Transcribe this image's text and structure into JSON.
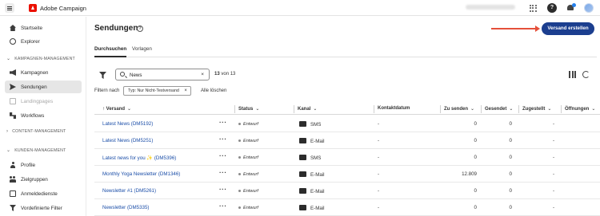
{
  "topbar": {
    "app_name": "Adobe Campaign",
    "help_glyph": "?",
    "icons": [
      "menu-icon",
      "adobe-logo",
      "apps-grid-icon",
      "help-icon",
      "bell-icon",
      "avatar"
    ]
  },
  "sidebar": {
    "top_items": [
      {
        "label": "Startseite",
        "icon": "home-icon"
      },
      {
        "label": "Explorer",
        "icon": "compass-icon"
      }
    ],
    "sections": [
      {
        "label": "KAMPAGNEN-MANAGEMENT",
        "expanded": true
      },
      {
        "label": "CONTENT-MANAGEMENT",
        "expanded": false
      },
      {
        "label": "KUNDEN-MANAGEMENT",
        "expanded": true
      }
    ],
    "campaign_items": [
      {
        "label": "Kampagnen",
        "icon": "megaphone-icon"
      },
      {
        "label": "Sendungen",
        "icon": "send-icon",
        "active": true
      },
      {
        "label": "Landingpages",
        "icon": "page-icon",
        "disabled": true
      },
      {
        "label": "Workflows",
        "icon": "workflow-icon"
      }
    ],
    "customer_items": [
      {
        "label": "Profile",
        "icon": "person-icon"
      },
      {
        "label": "Zielgruppen",
        "icon": "group-icon"
      },
      {
        "label": "Anmeldedienste",
        "icon": "service-icon"
      },
      {
        "label": "Vordefinierte Filter",
        "icon": "filter-icon"
      }
    ]
  },
  "page": {
    "title": "Sendungen",
    "create_button": "Versand erstellen",
    "tabs": [
      "Durchsuchen",
      "Vorlagen"
    ],
    "search": {
      "value": "News",
      "clear": "×"
    },
    "count_number": "13",
    "count_rest": "von 13",
    "filters_label": "Filtern nach",
    "filter_chip": "Typ: Nur Nicht-Testversand",
    "filter_chip_clear": "×",
    "clear_all": "Alle löschen"
  },
  "table": {
    "columns": {
      "versand": "Versand",
      "status": "Status",
      "kanal": "Kanal",
      "kontaktdatum": "Kontaktdatum",
      "zu_senden": "Zu senden",
      "gesendet": "Gesendet",
      "zugestellt": "Zugestellt",
      "oeffnungen": "Öffnungen"
    },
    "rows": [
      {
        "name": "Latest News (DM5192)",
        "status": "Entwurf",
        "channel": "SMS",
        "date": "-",
        "to_send": "0",
        "sent": "0",
        "delivered": "-"
      },
      {
        "name": "Latest News (DM5251)",
        "status": "Entwurf",
        "channel": "E-Mail",
        "date": "-",
        "to_send": "0",
        "sent": "0",
        "delivered": "-"
      },
      {
        "name": "Latest news for you ",
        "name_suffix": "(DM5396)",
        "sparkle": "✨",
        "status": "Entwurf",
        "channel": "SMS",
        "date": "-",
        "to_send": "0",
        "sent": "0",
        "delivered": "-"
      },
      {
        "name": "Monthly Yoga Newsletter (DM1346)",
        "status": "Entwurf",
        "channel": "E-Mail",
        "date": "-",
        "to_send": "12.809",
        "sent": "0",
        "delivered": "-"
      },
      {
        "name": "Newsletter #1 (DM5261)",
        "status": "Entwurf",
        "channel": "E-Mail",
        "date": "-",
        "to_send": "0",
        "sent": "0",
        "delivered": "-"
      },
      {
        "name": "Newsletter (DM5335)",
        "status": "Entwurf",
        "channel": "E-Mail",
        "date": "-",
        "to_send": "0",
        "sent": "0",
        "delivered": "-"
      }
    ]
  },
  "colors": {
    "accent": "#1b3e8f",
    "link": "#1b4ea8",
    "annotation_arrow": "#e5503a",
    "adobe_red": "#eb1000"
  }
}
